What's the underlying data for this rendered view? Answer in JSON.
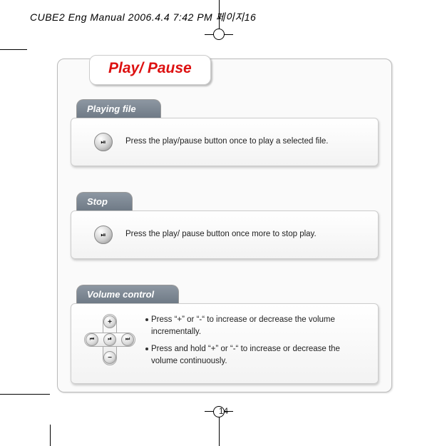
{
  "header": "CUBE2 Eng Manual  2006.4.4  7:42 PM  페이지16",
  "title": "Play/ Pause",
  "sections": {
    "playing": {
      "label": "Playing file",
      "text": "Press the play/pause button once to play a selected file."
    },
    "stop": {
      "label": "Stop",
      "text": "Press the play/ pause button once more to stop play."
    },
    "volume": {
      "label": "Volume control",
      "bullet1": "Press “+” or “-“ to increase or decrease the volume incrementally.",
      "bullet2": "Press and hold “+” or “-“ to increase or decrease the volume continuously."
    }
  },
  "dpad": {
    "up": "+",
    "down": "−",
    "left": "⏮",
    "right": "⏭",
    "center": "⏯"
  },
  "play_glyph": "⏯",
  "page_number": "14"
}
